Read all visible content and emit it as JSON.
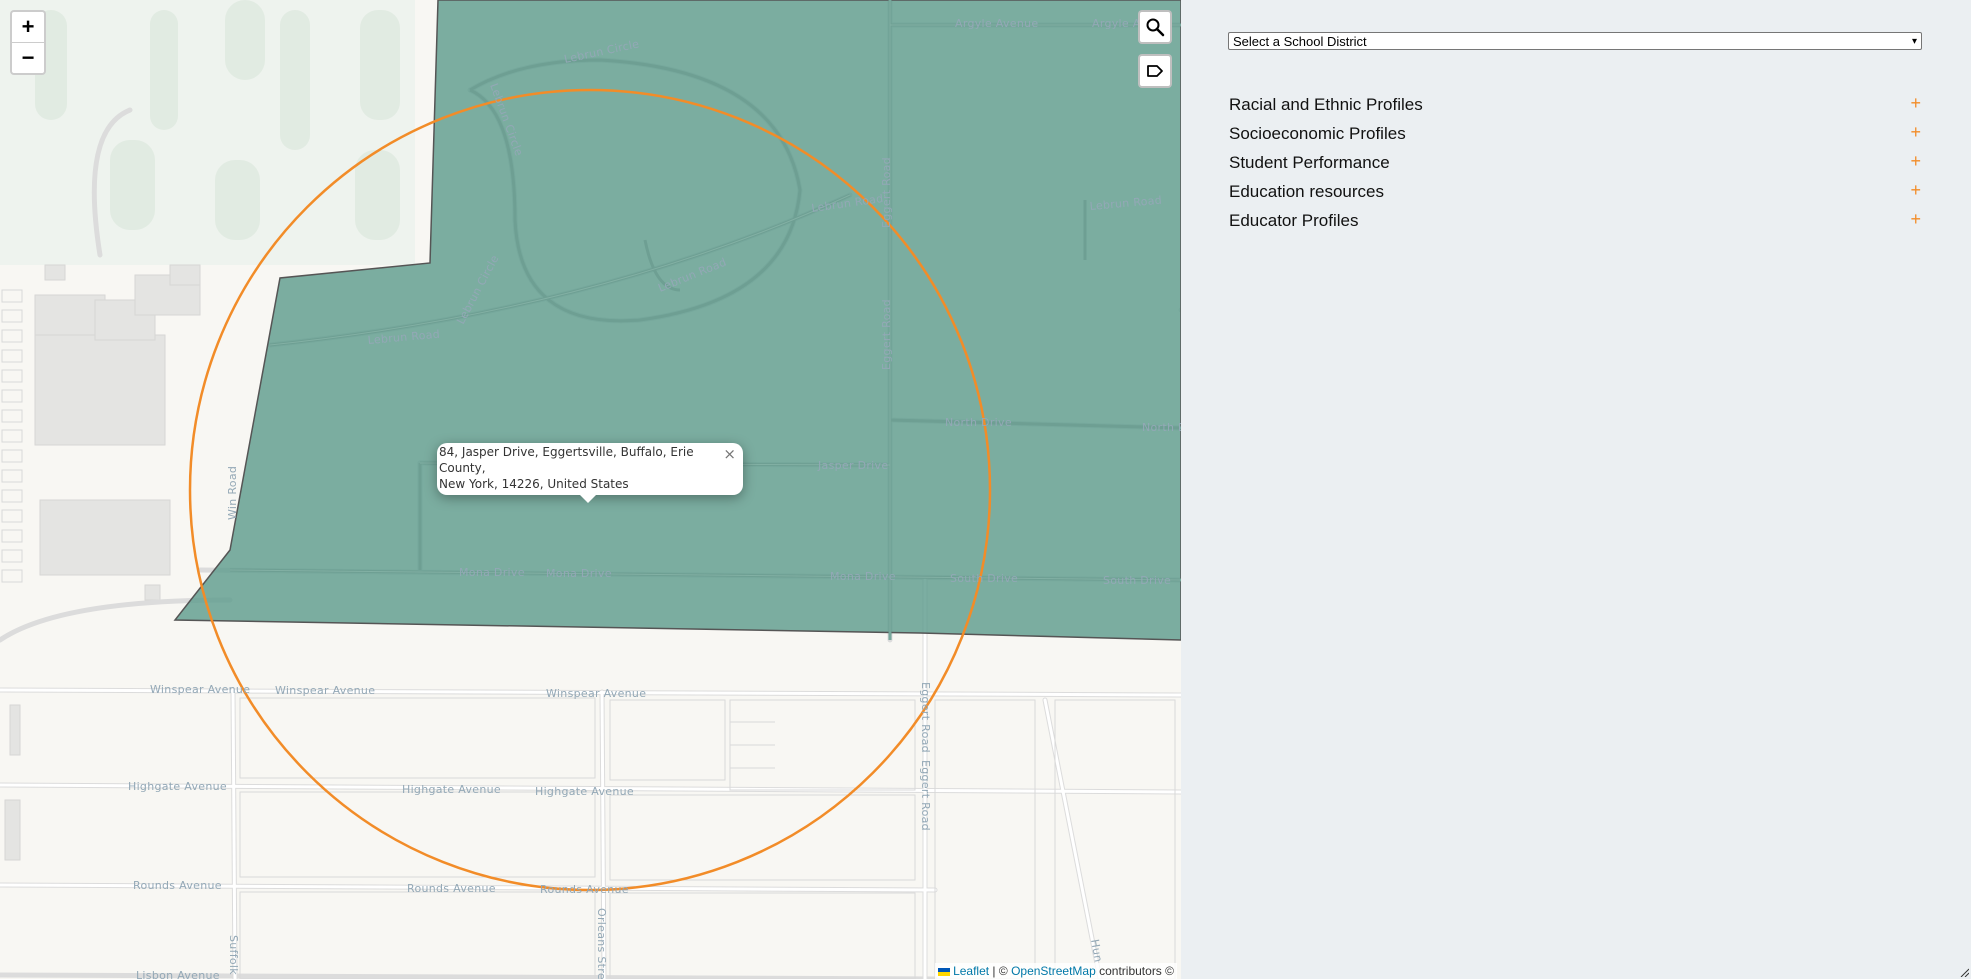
{
  "map": {
    "zoom_in": "+",
    "zoom_out": "−",
    "search_icon": "search-icon",
    "label_icon": "label-icon",
    "district_fill": "#5f9c8e",
    "radius_color": "#f28c28",
    "popup": {
      "line1": "84, Jasper Drive, Eggertsville, Buffalo, Erie County,",
      "line2": "New York, 14226, United States",
      "close": "×"
    },
    "streets": {
      "argyle1": "Argyle Avenue",
      "argyle2": "Argyle A",
      "lebrun_circle1": "Lebrun Circle",
      "lebrun_circle2": "Lebrun Circle",
      "lebrun_circle3": "Lebrun Circle",
      "lebrun_road1": "Lebrun Road",
      "lebrun_road2": "Lebrun Road",
      "lebrun_road3": "Lebrun Road",
      "lebrun_road4": "Lebrun Road",
      "eggert1": "Eggert Road",
      "eggert2": "Eggert Road",
      "eggert3": "Eggert Road",
      "eggert4": "Eggert Road",
      "north1": "North Drive",
      "north2": "North D",
      "jasper": "Jasper Drive",
      "mona1": "Mona Drive",
      "mona2": "Mona Drive",
      "mona3": "Mona Drive",
      "south1": "South Drive",
      "south2": "South Drive",
      "winspear1": "Winspear Avenue",
      "winspear2": "Winspear Avenue",
      "winspear3": "Winspear Avenue",
      "highgate1": "Highgate Avenue",
      "highgate2": "Highgate Avenue",
      "highgate3": "Highgate Avenue",
      "rounds1": "Rounds Avenue",
      "rounds2": "Rounds Avenue",
      "rounds3": "Rounds Avenue",
      "orleans": "Orleans Stre",
      "suffolk": "Suffolk",
      "lisbon": "Lisbon Avenue",
      "win_road": "Win Road",
      "hunt": "Hun"
    },
    "attribution": {
      "leaflet": "Leaflet",
      "sep": " | © ",
      "osm": "OpenStreetMap",
      "tail": " contributors ©"
    }
  },
  "panel": {
    "district_select": "Select a School District",
    "sections": [
      {
        "label": "Racial and Ethnic Profiles",
        "icon": "+"
      },
      {
        "label": "Socioeconomic Profiles",
        "icon": "+"
      },
      {
        "label": "Student Performance",
        "icon": "+"
      },
      {
        "label": "Education resources",
        "icon": "+"
      },
      {
        "label": "Educator Profiles",
        "icon": "+"
      }
    ]
  }
}
